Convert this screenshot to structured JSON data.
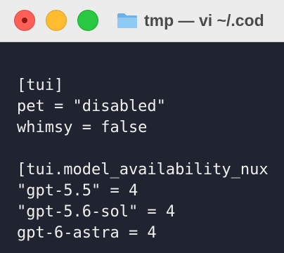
{
  "window": {
    "title": "tmp — vi ~/.cod"
  },
  "terminal": {
    "lines": [
      "[tui]",
      "pet = \"disabled\"",
      "whimsy = false",
      "",
      "[tui.model_availability_nux",
      "\"gpt-5.5\" = 4",
      "\"gpt-5.6-sol\" = 4",
      "gpt-6-astra = 4"
    ]
  },
  "colors": {
    "terminal_bg": "#1f2430",
    "terminal_fg": "#f0f0f0",
    "titlebar_bg": "#ececec",
    "close": "#fe5f57",
    "minimize": "#febc2e",
    "maximize": "#28c840",
    "folder": "#7fbff0"
  },
  "icons": {
    "folder": "folder-icon"
  }
}
